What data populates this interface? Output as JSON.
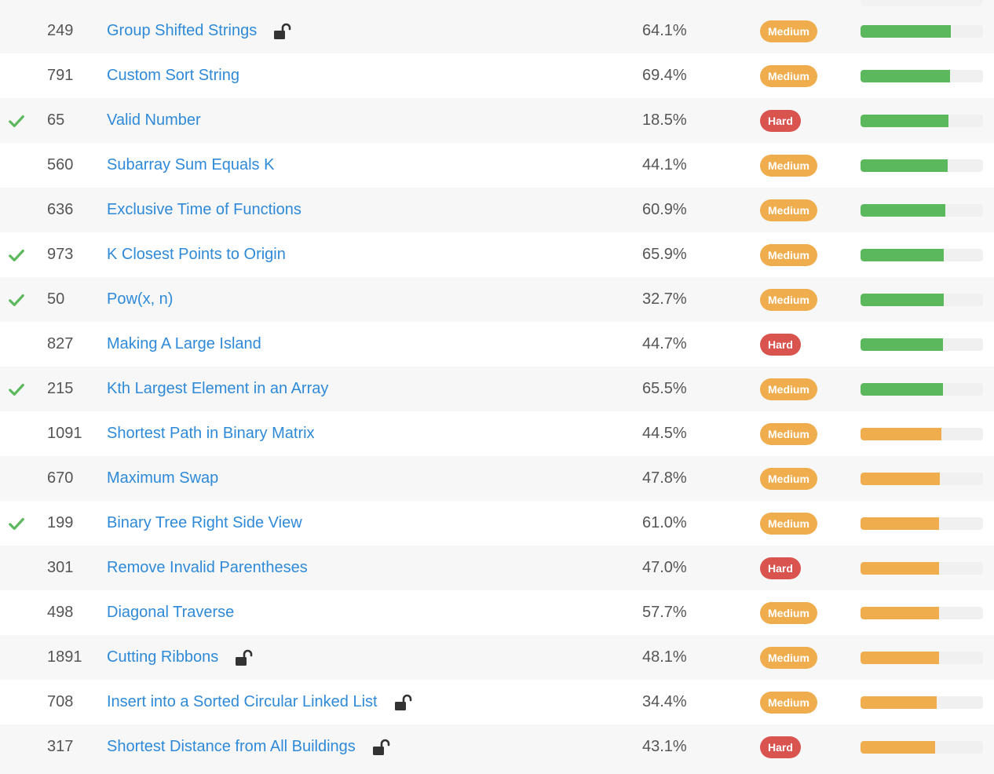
{
  "colors": {
    "title_link": "#2e8ad8",
    "solved_check": "#5cb85c",
    "lock_icon": "#333333",
    "difficulty": {
      "Medium": "#f0ad4e",
      "Hard": "#d9534f",
      "Easy": "#5cb85c"
    },
    "frequency_high": "#5cb85c",
    "frequency_mid": "#f0ad4e",
    "frequency_track": "#f0f0f0"
  },
  "icons": {
    "solved": "checkmark-icon",
    "premium": "unlock-icon"
  },
  "rows": [
    {
      "id": "249",
      "title": "Group Shifted Strings",
      "premium": true,
      "solved": false,
      "acceptance": "64.1%",
      "difficulty": "Medium",
      "frequency": 0.74,
      "freq_level": "high"
    },
    {
      "id": "791",
      "title": "Custom Sort String",
      "premium": false,
      "solved": false,
      "acceptance": "69.4%",
      "difficulty": "Medium",
      "frequency": 0.73,
      "freq_level": "high"
    },
    {
      "id": "65",
      "title": "Valid Number",
      "premium": false,
      "solved": true,
      "acceptance": "18.5%",
      "difficulty": "Hard",
      "frequency": 0.72,
      "freq_level": "high"
    },
    {
      "id": "560",
      "title": "Subarray Sum Equals K",
      "premium": false,
      "solved": false,
      "acceptance": "44.1%",
      "difficulty": "Medium",
      "frequency": 0.71,
      "freq_level": "high"
    },
    {
      "id": "636",
      "title": "Exclusive Time of Functions",
      "premium": false,
      "solved": false,
      "acceptance": "60.9%",
      "difficulty": "Medium",
      "frequency": 0.69,
      "freq_level": "high"
    },
    {
      "id": "973",
      "title": "K Closest Points to Origin",
      "premium": false,
      "solved": true,
      "acceptance": "65.9%",
      "difficulty": "Medium",
      "frequency": 0.68,
      "freq_level": "high"
    },
    {
      "id": "50",
      "title": "Pow(x, n)",
      "premium": false,
      "solved": true,
      "acceptance": "32.7%",
      "difficulty": "Medium",
      "frequency": 0.68,
      "freq_level": "high"
    },
    {
      "id": "827",
      "title": "Making A Large Island",
      "premium": false,
      "solved": false,
      "acceptance": "44.7%",
      "difficulty": "Hard",
      "frequency": 0.67,
      "freq_level": "high"
    },
    {
      "id": "215",
      "title": "Kth Largest Element in an Array",
      "premium": false,
      "solved": true,
      "acceptance": "65.5%",
      "difficulty": "Medium",
      "frequency": 0.67,
      "freq_level": "high"
    },
    {
      "id": "1091",
      "title": "Shortest Path in Binary Matrix",
      "premium": false,
      "solved": false,
      "acceptance": "44.5%",
      "difficulty": "Medium",
      "frequency": 0.66,
      "freq_level": "mid"
    },
    {
      "id": "670",
      "title": "Maximum Swap",
      "premium": false,
      "solved": false,
      "acceptance": "47.8%",
      "difficulty": "Medium",
      "frequency": 0.65,
      "freq_level": "mid"
    },
    {
      "id": "199",
      "title": "Binary Tree Right Side View",
      "premium": false,
      "solved": true,
      "acceptance": "61.0%",
      "difficulty": "Medium",
      "frequency": 0.64,
      "freq_level": "mid"
    },
    {
      "id": "301",
      "title": "Remove Invalid Parentheses",
      "premium": false,
      "solved": false,
      "acceptance": "47.0%",
      "difficulty": "Hard",
      "frequency": 0.64,
      "freq_level": "mid"
    },
    {
      "id": "498",
      "title": "Diagonal Traverse",
      "premium": false,
      "solved": false,
      "acceptance": "57.7%",
      "difficulty": "Medium",
      "frequency": 0.64,
      "freq_level": "mid"
    },
    {
      "id": "1891",
      "title": "Cutting Ribbons",
      "premium": true,
      "solved": false,
      "acceptance": "48.1%",
      "difficulty": "Medium",
      "frequency": 0.64,
      "freq_level": "mid"
    },
    {
      "id": "708",
      "title": "Insert into a Sorted Circular Linked List",
      "premium": true,
      "solved": false,
      "acceptance": "34.4%",
      "difficulty": "Medium",
      "frequency": 0.62,
      "freq_level": "mid"
    },
    {
      "id": "317",
      "title": "Shortest Distance from All Buildings",
      "premium": true,
      "solved": false,
      "acceptance": "43.1%",
      "difficulty": "Hard",
      "frequency": 0.61,
      "freq_level": "mid"
    }
  ]
}
